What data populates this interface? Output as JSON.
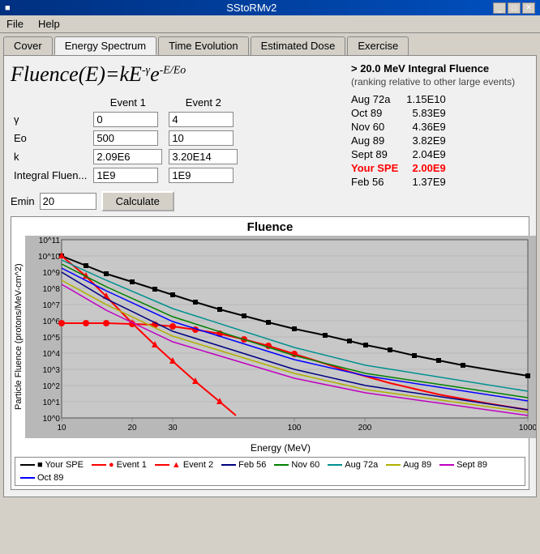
{
  "window": {
    "title": "SStoRMv2",
    "controls": [
      "_",
      "□",
      "✕"
    ]
  },
  "menu": {
    "items": [
      "File",
      "Help"
    ]
  },
  "tabs": [
    {
      "label": "Cover",
      "active": false
    },
    {
      "label": "Energy Spectrum",
      "active": true
    },
    {
      "label": "Time Evolution",
      "active": false
    },
    {
      "label": "Estimated Dose",
      "active": false
    },
    {
      "label": "Exercise",
      "active": false
    }
  ],
  "formula": {
    "text": "Fluence(E)=kE",
    "exponent1": "-γ",
    "base": "e",
    "exponent2": "-E/Eo"
  },
  "params": {
    "headers": [
      "",
      "Event 1",
      "Event 2"
    ],
    "rows": [
      {
        "label": "γ",
        "e1": "0",
        "e2": "4"
      },
      {
        "label": "Eo",
        "e1": "500",
        "e2": "10"
      },
      {
        "label": "k",
        "e1": "2.09E6",
        "e2": "3.20E14"
      },
      {
        "label": "Integral Fluen...",
        "e1": "1E9",
        "e2": "1E9"
      }
    ]
  },
  "emin": {
    "label": "Emin",
    "value": "20",
    "button": "Calculate"
  },
  "integral": {
    "heading": "> 20.0 MeV Integral Fluence",
    "subheading": "(ranking relative to other large events)",
    "events": [
      {
        "name": "Aug 72a",
        "value": "1.15E10",
        "highlight": false
      },
      {
        "name": "Oct 89",
        "value": "5.83E9",
        "highlight": false
      },
      {
        "name": "Nov 60",
        "value": "4.36E9",
        "highlight": false
      },
      {
        "name": "Aug 89",
        "value": "3.82E9",
        "highlight": false
      },
      {
        "name": "Sept 89",
        "value": "2.04E9",
        "highlight": false
      },
      {
        "name": "Your SPE",
        "value": "2.00E9",
        "highlight": true
      },
      {
        "name": "Feb 56",
        "value": "1.37E9",
        "highlight": false
      }
    ]
  },
  "chart": {
    "title": "Fluence",
    "y_label": "Particle Fluence (protons/MeV-cm^2)",
    "x_label": "Energy (MeV)",
    "y_ticks": [
      "10^11",
      "10^10",
      "10^9",
      "10^8",
      "10^7",
      "10^6",
      "10^5",
      "10^4",
      "10^3",
      "10^2",
      "10^1",
      "10^0"
    ],
    "x_ticks": [
      "10",
      "20",
      "30",
      "100",
      "200",
      "1000"
    ]
  },
  "legend": [
    {
      "label": "Your SPE",
      "color": "#000000",
      "marker": "■"
    },
    {
      "label": "Event 1",
      "color": "#ff0000",
      "marker": "●"
    },
    {
      "label": "Event 2",
      "color": "#ff0000",
      "marker": "▲"
    },
    {
      "label": "Feb 56",
      "color": "#000080",
      "marker": null
    },
    {
      "label": "Nov 60",
      "color": "#008000",
      "marker": null
    },
    {
      "label": "Aug 72a",
      "color": "#00a0a0",
      "marker": null
    },
    {
      "label": "Aug 89",
      "color": "#e0e000",
      "marker": null
    },
    {
      "label": "Sept 89",
      "color": "#c000c0",
      "marker": null
    },
    {
      "label": "Oct 89",
      "color": "#0000ff",
      "marker": null
    }
  ]
}
